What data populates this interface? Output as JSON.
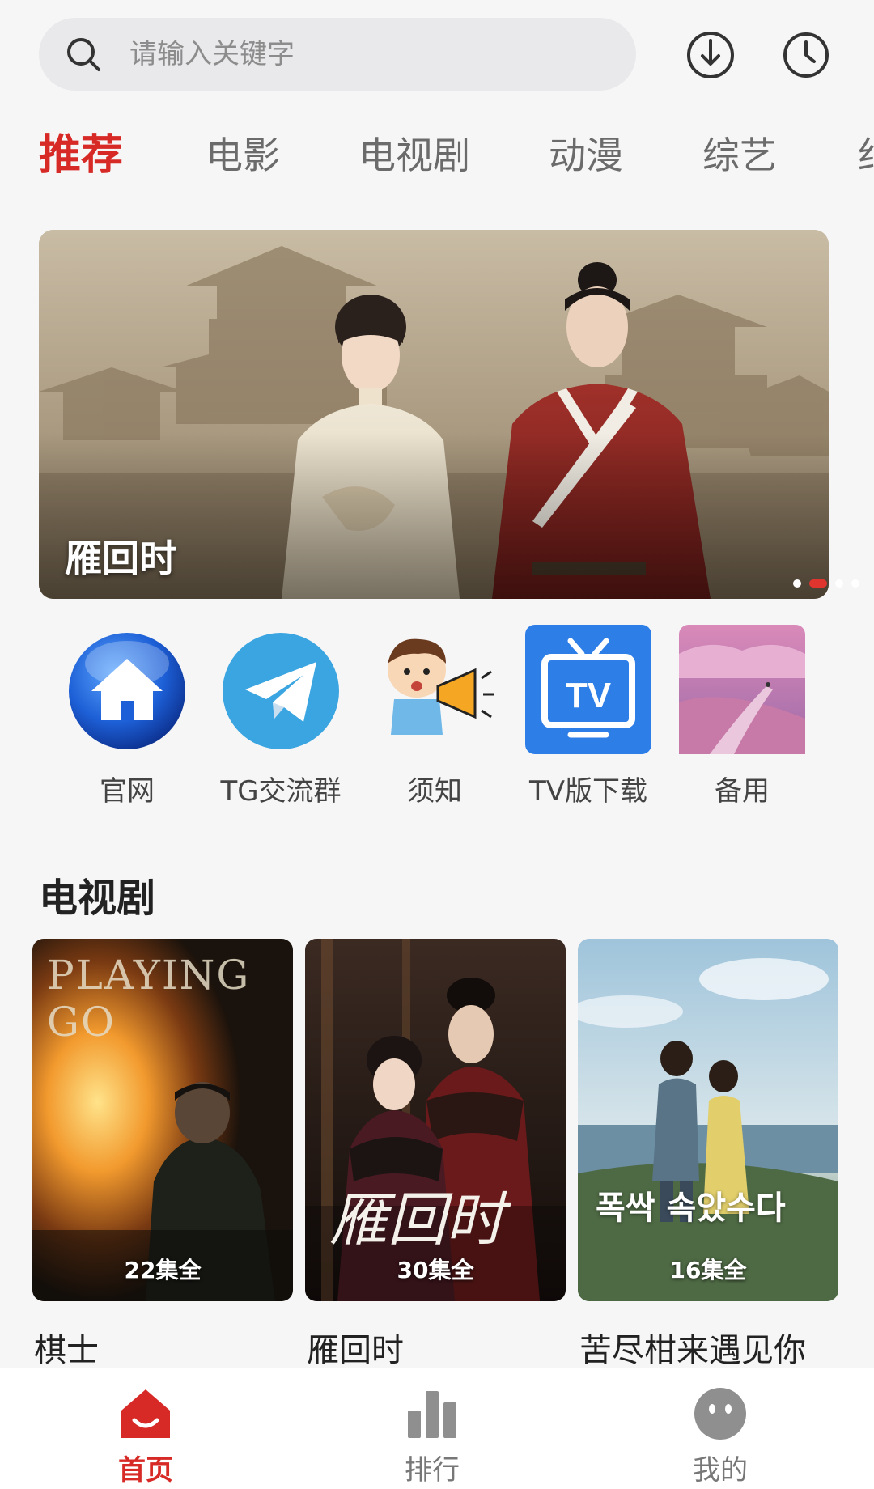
{
  "search": {
    "placeholder": "请输入关键字"
  },
  "header": {
    "download_icon": "download-icon",
    "history_icon": "history-clock-icon"
  },
  "tabs": [
    {
      "label": "推荐",
      "active": true
    },
    {
      "label": "电影"
    },
    {
      "label": "电视剧"
    },
    {
      "label": "动漫"
    },
    {
      "label": "综艺"
    }
  ],
  "banner": {
    "title": "雁回时",
    "slide_count": 4,
    "active_slide": 2
  },
  "shortcuts": [
    {
      "label": "官网",
      "icon": "home-globe-icon"
    },
    {
      "label": "TG交流群",
      "icon": "telegram-icon"
    },
    {
      "label": "须知",
      "icon": "megaphone-boy-icon"
    },
    {
      "label": "TV版下载",
      "icon": "tv-icon"
    },
    {
      "label": "备用",
      "icon": "scenery-icon"
    }
  ],
  "section": {
    "title": "电视剧",
    "items": [
      {
        "title": "棋士",
        "episodes": "22集全",
        "poster_text": "PLAYING GO"
      },
      {
        "title": "雁回时",
        "episodes": "30集全",
        "poster_text": "雁回时"
      },
      {
        "title": "苦尽柑来遇见你",
        "episodes": "16集全",
        "poster_text": "폭싹 속았수다"
      }
    ]
  },
  "bottom_nav": [
    {
      "label": "首页",
      "icon": "home-icon",
      "active": true
    },
    {
      "label": "排行",
      "icon": "ranking-bars-icon"
    },
    {
      "label": "我的",
      "icon": "profile-face-icon"
    }
  ],
  "colors": {
    "accent": "#d72a26",
    "tab_inactive": "#6b6b6b",
    "background": "#f6f6f7"
  }
}
